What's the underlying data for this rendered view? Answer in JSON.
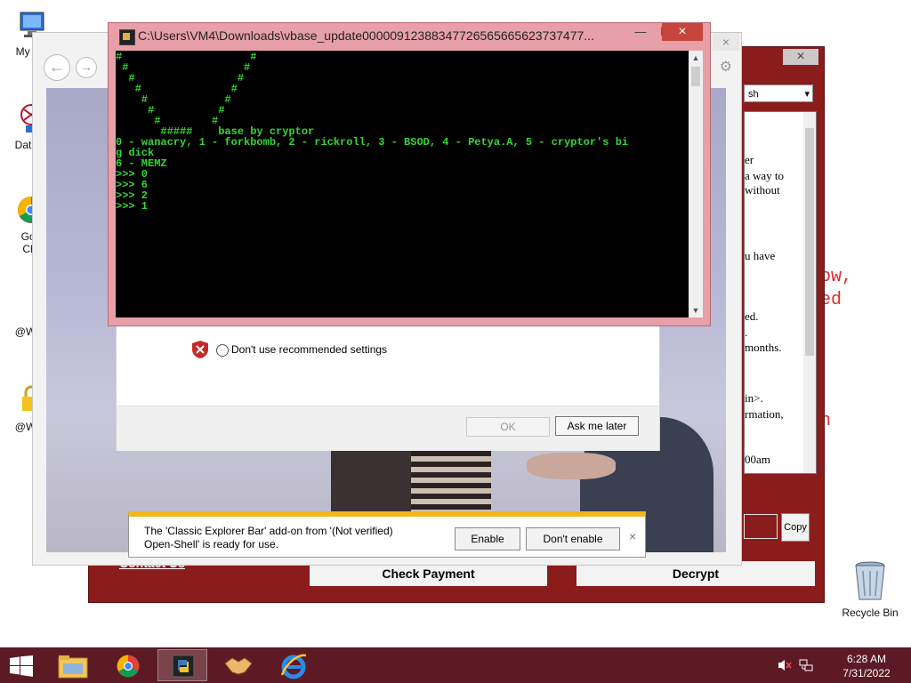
{
  "desktop": {
    "icons": [
      {
        "label": "My Co"
      },
      {
        "label": "DataW"
      },
      {
        "label": "Goo"
      },
      {
        "label": "Chr"
      },
      {
        "label": "@Wan"
      },
      {
        "label": "@Wan"
      }
    ],
    "recycle_bin": "Recycle Bin",
    "red_text": [
      "ow,",
      "ed",
      "n"
    ]
  },
  "ransom": {
    "close": "×",
    "language": "sh",
    "note_lines": [
      "er",
      "a way to",
      "without",
      "u have",
      "ed.",
      ".",
      "months.",
      "in>.",
      "rmation,",
      "00am"
    ],
    "copy": "Copy",
    "check_payment": "Check Payment",
    "decrypt": "Decrypt",
    "contact": "Contact Us"
  },
  "ie": {
    "back": "←",
    "forward": "→",
    "close": "×"
  },
  "dialog": {
    "radio_label": "Don't use recommended settings",
    "ok": "OK",
    "ask_later": "Ask me later"
  },
  "console": {
    "title": "C:\\Users\\VM4\\Downloads\\vbase_update00000912388347726565665623737477...",
    "minimize": "—",
    "maximize": "☐",
    "close": "×",
    "lines": [
      "#                    #",
      " #                  #",
      "  #                #",
      "   #              #",
      "    #            #",
      "     #          #",
      "      #        #",
      "       #####    base by cryptor",
      "0 - wanacry, 1 - forkbomb, 2 - rickroll, 3 - BSOD, 4 - Petya.A, 5 - cryptor's bi",
      "g dick",
      "6 - MEMZ",
      ">>> 0",
      ">>> 6",
      ">>> 2",
      ">>> 1"
    ]
  },
  "notification": {
    "message": "The 'Classic Explorer Bar' add-on from '(Not verified) Open-Shell' is ready for use.",
    "enable": "Enable",
    "dont_enable": "Don't enable",
    "close": "×"
  },
  "taskbar": {
    "time": "6:28 AM",
    "date": "7/31/2022"
  }
}
